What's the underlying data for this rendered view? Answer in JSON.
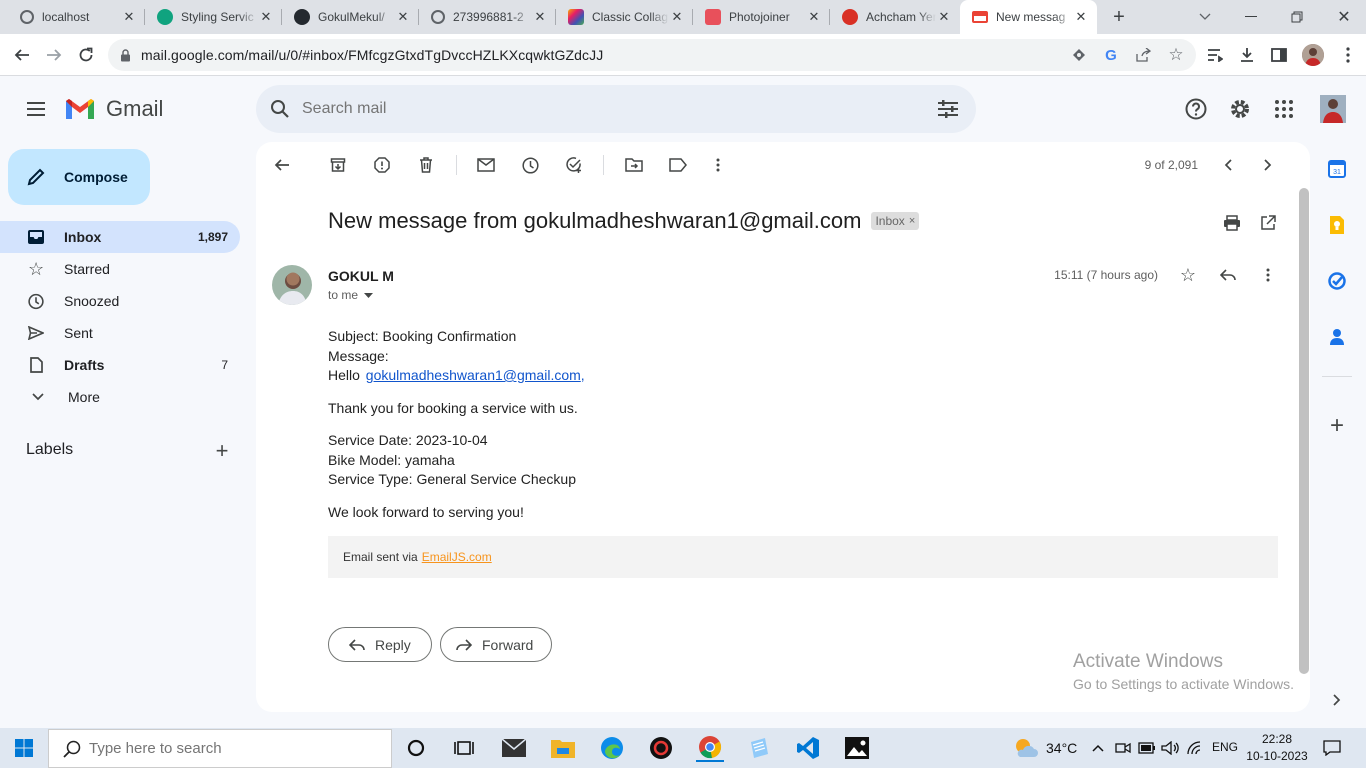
{
  "browser": {
    "tabs": [
      {
        "title": "localhost",
        "color": "#5f6368"
      },
      {
        "title": "Styling Servic",
        "color": "#10a37f"
      },
      {
        "title": "GokulMekul/",
        "color": "#24292f"
      },
      {
        "title": "273996881-2",
        "color": "#5f6368"
      },
      {
        "title": "Classic Collag",
        "color": "#f4b400"
      },
      {
        "title": "Photojoiner",
        "color": "#e8505b"
      },
      {
        "title": "Achcham Yer",
        "color": "#d93025"
      },
      {
        "title": "New messag",
        "color": "#ea4335"
      }
    ],
    "url": "mail.google.com/mail/u/0/#inbox/FMfcgzGtxdTgDvccHZLKXcqwktGZdcJJ"
  },
  "gmail": {
    "brand": "Gmail",
    "search_placeholder": "Search mail",
    "compose_label": "Compose",
    "nav": [
      {
        "label": "Inbox",
        "count": "1,897",
        "icon": "inbox-icon"
      },
      {
        "label": "Starred",
        "count": "",
        "icon": "star-icon"
      },
      {
        "label": "Snoozed",
        "count": "",
        "icon": "clock-icon"
      },
      {
        "label": "Sent",
        "count": "",
        "icon": "send-icon"
      },
      {
        "label": "Drafts",
        "count": "7",
        "icon": "draft-icon"
      },
      {
        "label": "More",
        "count": "",
        "icon": "chevron-down-icon"
      }
    ],
    "labels_heading": "Labels",
    "pagination": "9 of 2,091",
    "message": {
      "subject": "New message from gokulmadheshwaran1@gmail.com",
      "badge": "Inbox",
      "sender": "GOKUL M",
      "to": "to me",
      "time": "15:11 (7 hours ago)",
      "body": {
        "subject_line": "Subject: Booking Confirmation",
        "message_label": "Message:",
        "hello": "Hello",
        "email_link": "gokulmadheshwaran1@gmail.com",
        "hello_suffix": ",",
        "thanks": "Thank you for booking a service with us.",
        "service_date": "Service Date: 2023-10-04",
        "bike_model": "Bike Model: yamaha",
        "service_type": "Service Type: General Service Checkup",
        "closing": "We look forward to serving you!",
        "footer_prefix": "Email sent via",
        "footer_link": "EmailJS.com"
      },
      "reply_label": "Reply",
      "forward_label": "Forward"
    },
    "watermark": {
      "title": "Activate Windows",
      "subtitle": "Go to Settings to activate Windows."
    }
  },
  "taskbar": {
    "search_placeholder": "Type here to search",
    "temperature": "34°C",
    "language": "ENG",
    "time": "22:28",
    "date": "10-10-2023"
  },
  "colors": {
    "gmail_red": "#ea4335",
    "nav_active": "#d3e3fd",
    "compose_bg": "#c2e7ff",
    "link": "#1155cc",
    "emailjs_orange": "#f7941d"
  }
}
